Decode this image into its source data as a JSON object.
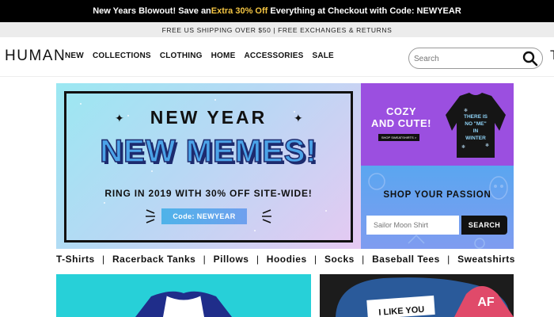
{
  "promo": {
    "text_before": "New Years Blowout! Save an ",
    "highlight": "Extra 30% Off",
    "text_after": " Everything at Checkout with Code: NEWYEAR",
    "highlight_color": "#f4c542"
  },
  "shipping": {
    "text": "FREE US SHIPPING OVER $50 | FREE EXCHANGES & RETURNS"
  },
  "header": {
    "logo": "HUMAN",
    "nav": [
      "NEW",
      "COLLECTIONS",
      "CLOTHING",
      "HOME",
      "ACCESSORIES",
      "SALE"
    ],
    "search_placeholder": "Search",
    "search_icon": "search-icon",
    "edge_glyph": "T"
  },
  "hero": {
    "tagline": "NEW YEAR",
    "title": "NEW MEMES!",
    "subtitle": "RING IN 2019 WITH 30% OFF SITE-WIDE!",
    "code_label": "Code: NEWYEAR",
    "colors": {
      "title_fill": "#4ba3e8",
      "title_outline": "#1d2b6e"
    }
  },
  "side_promo": {
    "title_line1": "COZY",
    "title_line2": "AND CUTE!",
    "button": "SHOP SWEATSHIRTS >",
    "shirt_text_1": "THERE IS",
    "shirt_text_2": "NO \"ME\"",
    "shirt_text_3": "IN",
    "shirt_text_4": "WINTER",
    "bg_color": "#9b4fe0"
  },
  "passion_search": {
    "title": "SHOP YOUR PASSION",
    "placeholder": "Sailor Moon Shirt",
    "button": "SEARCH"
  },
  "categories": [
    "T-Shirts",
    "Racerback Tanks",
    "Pillows",
    "Hoodies",
    "Socks",
    "Baseball Tees",
    "Sweatshirts"
  ],
  "tiles": {
    "tile2_card_text": "I LIKE YOU",
    "tile2_heart_text": "AF"
  }
}
